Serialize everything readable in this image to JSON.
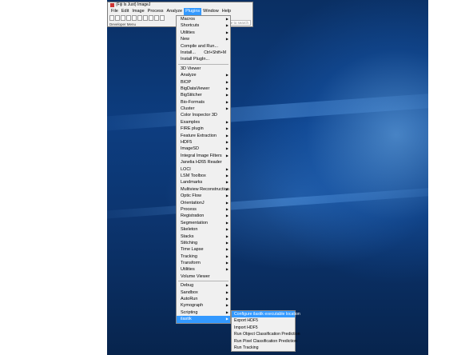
{
  "window": {
    "title": "(Fiji Is Just) ImageJ",
    "menubar": [
      "File",
      "Edit",
      "Image",
      "Process",
      "Analyze",
      "Plugins",
      "Window",
      "Help"
    ],
    "status": "Developer Menu",
    "search_placeholder": "Click here to search"
  },
  "colors": {
    "highlight": "#3399ff",
    "menu_bg": "#f0f0f0"
  },
  "plugins_menu": [
    {
      "label": "Macros",
      "submenu": true
    },
    {
      "label": "Shortcuts",
      "submenu": true
    },
    {
      "label": "Utilities",
      "submenu": true
    },
    {
      "label": "New",
      "submenu": true
    },
    {
      "label": "Compile and Run..."
    },
    {
      "label": "Install...",
      "shortcut": "Ctrl+Shift+M"
    },
    {
      "label": "Install PlugIn..."
    },
    {
      "separator": true
    },
    {
      "label": "3D Viewer"
    },
    {
      "label": "Analyze",
      "submenu": true
    },
    {
      "label": "BIOP",
      "submenu": true
    },
    {
      "label": "BigDataViewer",
      "submenu": true
    },
    {
      "label": "BigStitcher",
      "submenu": true
    },
    {
      "label": "Bio-Formats",
      "submenu": true
    },
    {
      "label": "Cluster",
      "submenu": true
    },
    {
      "label": "Color Inspector 3D"
    },
    {
      "label": "Examples",
      "submenu": true
    },
    {
      "label": "FIRE plugin",
      "submenu": true
    },
    {
      "label": "Feature Extraction",
      "submenu": true
    },
    {
      "label": "HDF5",
      "submenu": true
    },
    {
      "label": "ImageSD",
      "submenu": true
    },
    {
      "label": "Integral Image Filters",
      "submenu": true
    },
    {
      "label": "Janelia H265 Reader"
    },
    {
      "label": "LOCI",
      "submenu": true
    },
    {
      "label": "LSM Toolbox",
      "submenu": true
    },
    {
      "label": "Landmarks",
      "submenu": true
    },
    {
      "label": "Multiview Reconstruction",
      "submenu": true
    },
    {
      "label": "Optic Flow",
      "submenu": true
    },
    {
      "label": "OrientationJ",
      "submenu": true
    },
    {
      "label": "Process",
      "submenu": true
    },
    {
      "label": "Registration",
      "submenu": true
    },
    {
      "label": "Segmentation",
      "submenu": true
    },
    {
      "label": "Skeleton",
      "submenu": true
    },
    {
      "label": "Stacks",
      "submenu": true
    },
    {
      "label": "Stitching",
      "submenu": true
    },
    {
      "label": "Time Lapse",
      "submenu": true
    },
    {
      "label": "Tracking",
      "submenu": true
    },
    {
      "label": "Transform",
      "submenu": true
    },
    {
      "label": "Utilities",
      "submenu": true
    },
    {
      "label": "Volume Viewer"
    },
    {
      "separator": true
    },
    {
      "label": "Debug",
      "submenu": true
    },
    {
      "label": "Sandbox",
      "submenu": true
    },
    {
      "label": "AutoRun",
      "submenu": true
    },
    {
      "label": "Kymograph",
      "submenu": true
    },
    {
      "label": "Scripting",
      "submenu": true
    },
    {
      "label": "ilastik",
      "submenu": true,
      "highlighted": true
    }
  ],
  "ilastik_submenu": [
    {
      "label": "Configure ilastik executable location",
      "highlighted": true
    },
    {
      "label": "Export HDF5"
    },
    {
      "label": "Import HDF5"
    },
    {
      "label": "Run Object Classification Prediction"
    },
    {
      "label": "Run Pixel Classification Prediction"
    },
    {
      "label": "Run Tracking"
    }
  ]
}
